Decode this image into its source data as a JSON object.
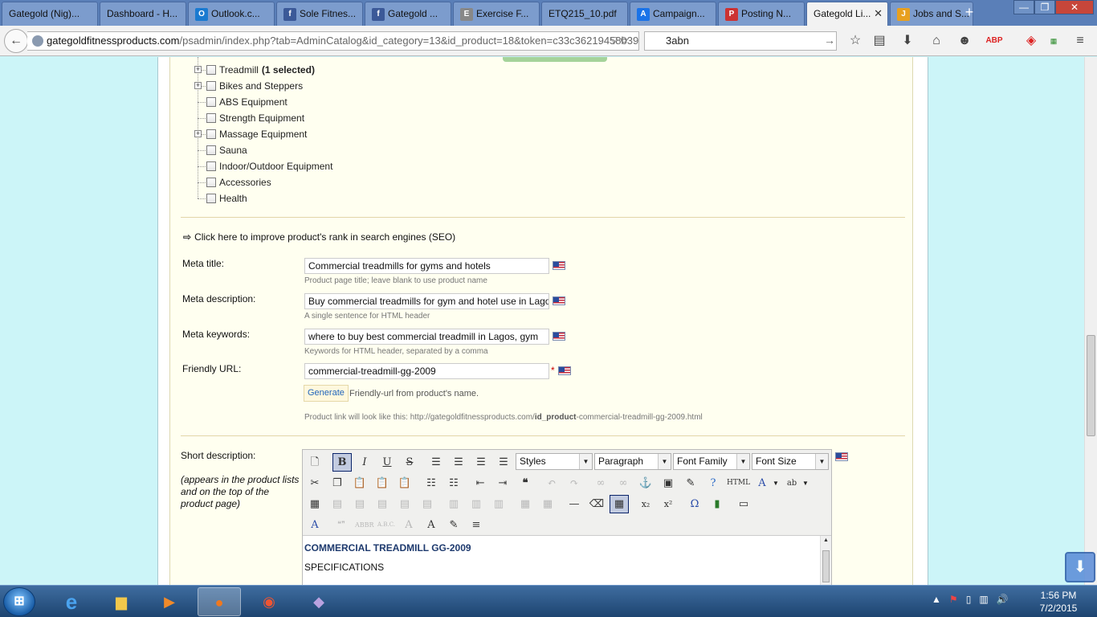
{
  "browser": {
    "tabs": [
      {
        "label": "Gategold (Nig)...",
        "active": false
      },
      {
        "label": "Dashboard - H...",
        "active": false
      },
      {
        "label": "Outlook.c...",
        "active": false
      },
      {
        "label": "Sole Fitnes...",
        "active": false
      },
      {
        "label": "Gategold ...",
        "active": false
      },
      {
        "label": "Exercise F...",
        "active": false
      },
      {
        "label": "ETQ215_10.pdf",
        "active": false
      },
      {
        "label": "Campaign...",
        "active": false
      },
      {
        "label": "Posting N...",
        "active": false
      },
      {
        "label": "Gategold Li...",
        "active": true
      },
      {
        "label": "Jobs and S...",
        "active": false
      }
    ],
    "url_host": "gategoldfitnessproducts.com",
    "url_path": "/psadmin/index.php?tab=AdminCatalog&id_category=13&id_product=18&token=c33c36219458b394",
    "search_value": "3abn"
  },
  "categories": [
    {
      "label": "Treadmill",
      "selected_note": "(1 selected)",
      "expandable": true
    },
    {
      "label": "Bikes and Steppers",
      "selected_note": "",
      "expandable": true
    },
    {
      "label": "ABS Equipment",
      "selected_note": "",
      "expandable": false
    },
    {
      "label": "Strength Equipment",
      "selected_note": "",
      "expandable": false
    },
    {
      "label": "Massage Equipment",
      "selected_note": "",
      "expandable": true
    },
    {
      "label": "Sauna",
      "selected_note": "",
      "expandable": false
    },
    {
      "label": "Indoor/Outdoor Equipment",
      "selected_note": "",
      "expandable": false
    },
    {
      "label": "Accessories",
      "selected_note": "",
      "expandable": false
    },
    {
      "label": "Health",
      "selected_note": "",
      "expandable": false
    }
  ],
  "seo": {
    "link_text": "Click here to improve product's rank in search engines (SEO)",
    "meta_title": {
      "label": "Meta title:",
      "value": "Commercial treadmills for gyms and hotels",
      "hint": "Product page title; leave blank to use product name"
    },
    "meta_description": {
      "label": "Meta description:",
      "value": "Buy commercial treadmills for gym and hotel use in Lagos",
      "hint": "A single sentence for HTML header"
    },
    "meta_keywords": {
      "label": "Meta keywords:",
      "value": "where to buy best commercial treadmill in Lagos, gym",
      "hint": "Keywords for HTML header, separated by a comma"
    },
    "friendly_url": {
      "label": "Friendly URL:",
      "value": "commercial-treadmill-gg-2009",
      "required_mark": "*"
    },
    "generate_label": "Generate",
    "generate_hint": "Friendly-url from product's name.",
    "product_link_prefix": "Product link will look like this: http://gategoldfitnessproducts.com/",
    "product_link_bold": "id_product",
    "product_link_suffix": "-commercial-treadmill-gg-2009.html"
  },
  "short_description": {
    "label": "Short description:",
    "note": "(appears in the product lists and on the top of the product page)",
    "editor": {
      "styles_select": "Styles",
      "format_select": "Paragraph",
      "font_family_select": "Font Family",
      "font_size_select": "Font Size",
      "heading_text": "COMMERCIAL TREADMILL GG-2009",
      "sub_text": "SPECIFICATIONS"
    }
  },
  "taskbar": {
    "time": "1:56 PM",
    "date": "7/2/2015"
  }
}
